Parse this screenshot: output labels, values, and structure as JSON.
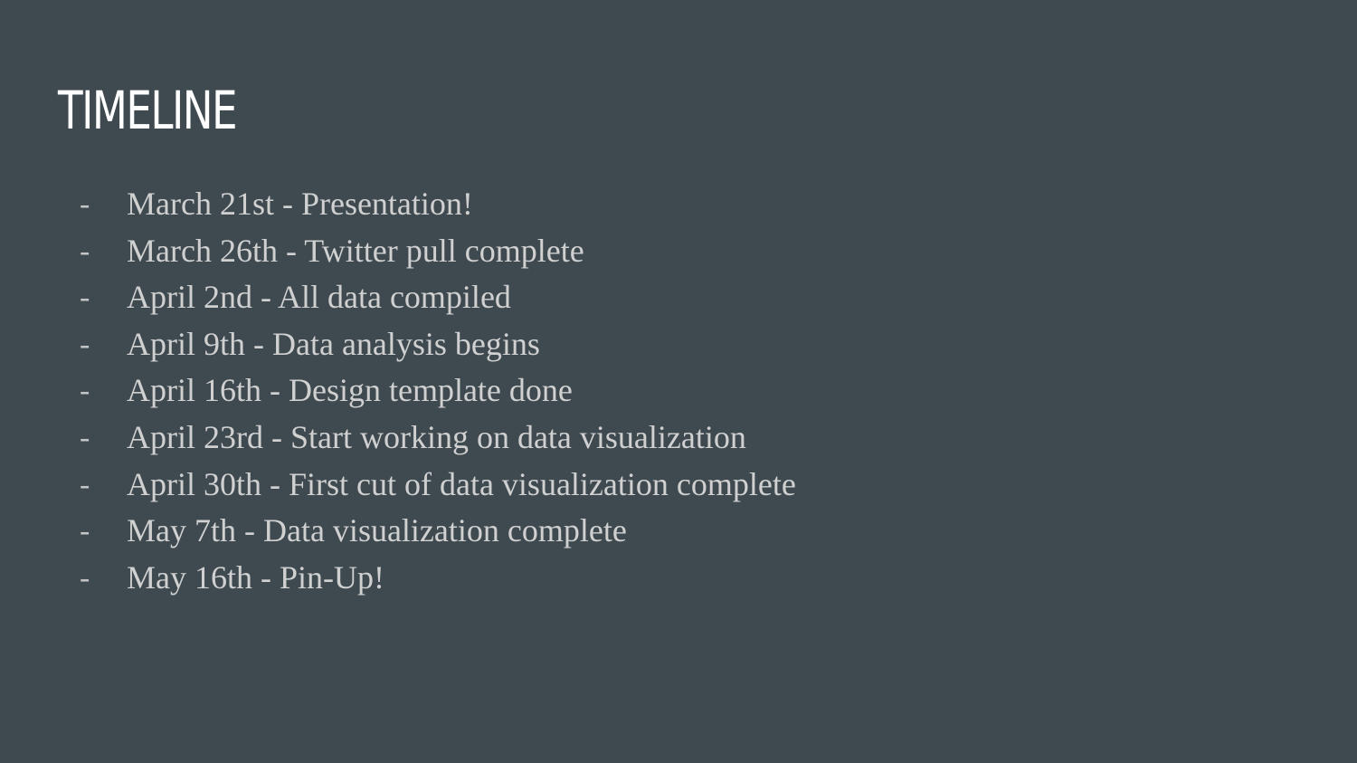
{
  "slide": {
    "title": "TIMELINE",
    "bullet": "-",
    "items": [
      {
        "text": "March 21st - Presentation!"
      },
      {
        "text": "March 26th - Twitter pull complete"
      },
      {
        "text": "April 2nd - All data compiled"
      },
      {
        "text": "April 9th - Data analysis begins"
      },
      {
        "text": "April 16th - Design template done"
      },
      {
        "text": "April 23rd - Start working on data visualization"
      },
      {
        "text": "April 30th - First cut of data visualization complete"
      },
      {
        "text": "May 7th - Data visualization complete"
      },
      {
        "text": "May 16th - Pin-Up!"
      }
    ]
  },
  "colors": {
    "background": "#3e4a50",
    "title": "#ffffff",
    "body_text": "#d0d0d0"
  }
}
